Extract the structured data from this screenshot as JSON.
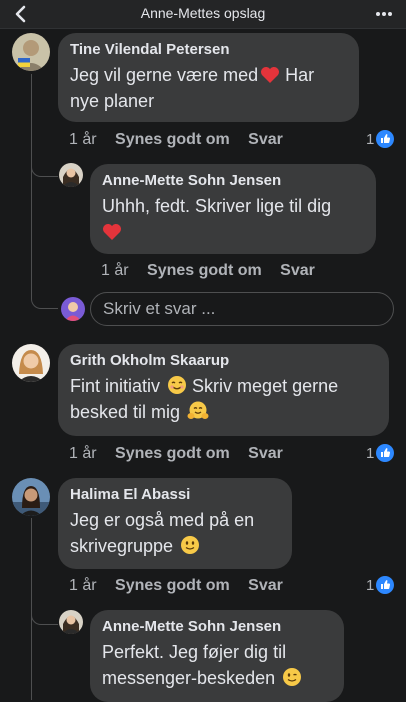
{
  "header": {
    "title": "Anne-Mettes opslag"
  },
  "icons": {
    "back": "chevron-left-icon",
    "more": "more-horizontal-icon",
    "like": "like-badge-icon"
  },
  "colors": {
    "background": "#18191a",
    "bubble": "#3a3b3c",
    "accent": "#2d88ff",
    "heart": "#e4343b"
  },
  "comments": [
    {
      "author": "Tine Vilendal Petersen",
      "text_before": "Jeg vil gerne være med",
      "emoji": "red-heart",
      "text_after": " Har nye planer",
      "time": "1 år",
      "like_label": "Synes godt om",
      "reply_label": "Svar",
      "reactions": "1"
    },
    {
      "author": "Anne-Mette Sohn Jensen",
      "text": "Uhhh, fedt. Skriver lige til dig",
      "emoji": "red-heart",
      "time": "1 år",
      "like_label": "Synes godt om",
      "reply_label": "Svar"
    },
    {
      "author": "Grith Okholm Skaarup",
      "text_line1": "Fint initiativ",
      "emoji1": "smiling-face",
      "text_line1b": " Skriv meget gerne",
      "text_line2": "besked til mig",
      "emoji2": "hugging-face",
      "time": "1 år",
      "like_label": "Synes godt om",
      "reply_label": "Svar",
      "reactions": "1"
    },
    {
      "author": "Halima El Abassi",
      "text_line1": "Jeg er også med på en",
      "text_line2": "skrivegruppe",
      "emoji": "slightly-smiling-face",
      "time": "1 år",
      "like_label": "Synes godt om",
      "reply_label": "Svar",
      "reactions": "1"
    },
    {
      "author": "Anne-Mette Sohn Jensen",
      "text_line1": "Perfekt. Jeg føjer dig til",
      "text_line2": "messenger-beskeden",
      "emoji": "winking-face"
    }
  ],
  "reply_input": {
    "placeholder": "Skriv et svar ..."
  }
}
